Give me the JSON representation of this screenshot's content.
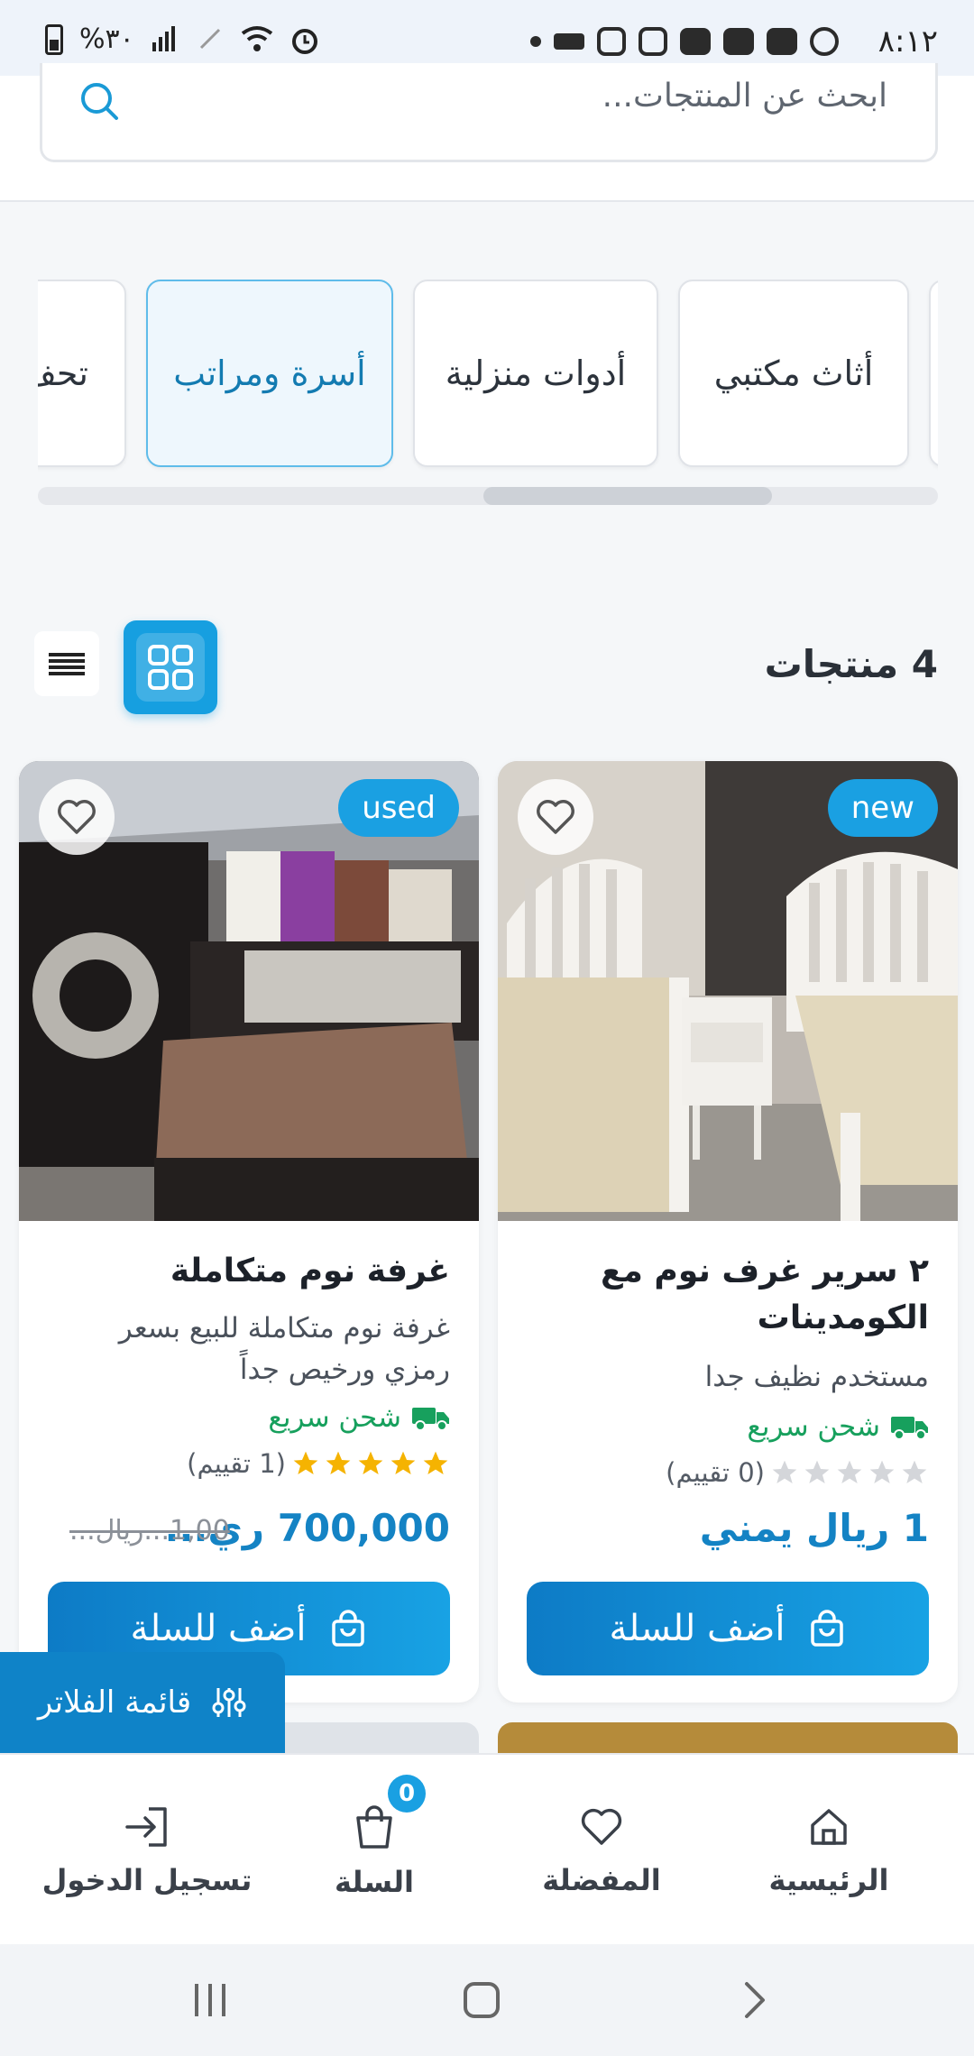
{
  "status_bar": {
    "time": "٨:١٢",
    "battery": "%٣٠"
  },
  "search": {
    "placeholder": "ابحث عن المنتجات..."
  },
  "categories": [
    {
      "label": "أثاث مكتبي"
    },
    {
      "label": "أدوات منزلية"
    },
    {
      "label": "أسرة ومراتب",
      "active": true
    },
    {
      "label": "تحف"
    }
  ],
  "toolbar": {
    "count_label": "4 منتجات"
  },
  "products": [
    {
      "badge": "new",
      "title": "٢ سرير غرف نوم مع الكومدينات",
      "description": "مستخدم نظيف جدا",
      "shipping": "شحن سريع",
      "rating_stars": 0,
      "rating_text": "(0 تقييم)",
      "price": "1 ريال يمني",
      "old_price": "",
      "button": "أضف للسلة"
    },
    {
      "badge": "used",
      "title": "غرفة نوم متكاملة",
      "description": "غرفة نوم متكاملة للبيع بسعر رمزي ورخيص جداً",
      "shipping": "شحن سريع",
      "rating_stars": 5,
      "rating_text": "(1 تقييم)",
      "price": "700,000 ري...",
      "old_price": "1,00...ريال...",
      "button": "أضف للسلة"
    }
  ],
  "filter_button": "قائمة الفلاتر",
  "bottom_nav": {
    "home": "الرئيسية",
    "favorites": "المفضلة",
    "cart": "السلة",
    "cart_count": "0",
    "login": "تسجيل الدخول"
  },
  "colors": {
    "accent": "#1aa0e2",
    "accent_dark": "#0d7bc6",
    "shipping_green": "#17a05d",
    "star_gold": "#f5b301"
  }
}
